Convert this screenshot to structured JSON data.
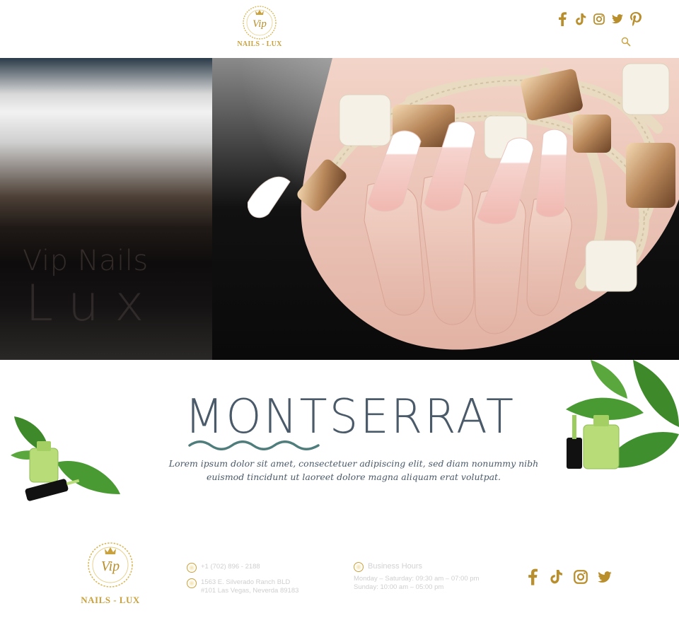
{
  "brand": {
    "logo_monogram": "Vip",
    "logo_text": "NAILS - LUX"
  },
  "colors": {
    "gold": "#c9a13d",
    "slate": "#4a5a69",
    "muted": "#cfcfcf"
  },
  "header": {
    "social": [
      {
        "name": "facebook-icon"
      },
      {
        "name": "tiktok-icon"
      },
      {
        "name": "instagram-icon"
      },
      {
        "name": "twitter-icon"
      },
      {
        "name": "pinterest-icon"
      }
    ],
    "search_icon": "search-icon"
  },
  "hero": {
    "title_line1": "Vip Nails",
    "title_line2": "Lux"
  },
  "section": {
    "heading": "MONTSERRAT",
    "body": "Lorem ipsum dolor sit amet, consectetuer adipiscing elit, sed diam nonummy nibh euismod tincidunt ut laoreet dolore magna aliquam erat volutpat."
  },
  "footer": {
    "phone": "+1 (702) 896 - 2188",
    "address_line1": "1563 E. Silverado Ranch BLD",
    "address_line2": "#101 Las Vegas, Neverda 89183",
    "hours_title": "Business Hours",
    "hours_line1": "Monday – Saturday: 09:30 am – 07:00 pm",
    "hours_line2": "Sunday: 10:00 am – 05:00 pm",
    "social": [
      {
        "name": "facebook-icon"
      },
      {
        "name": "tiktok-icon"
      },
      {
        "name": "instagram-icon"
      },
      {
        "name": "twitter-icon"
      }
    ]
  }
}
